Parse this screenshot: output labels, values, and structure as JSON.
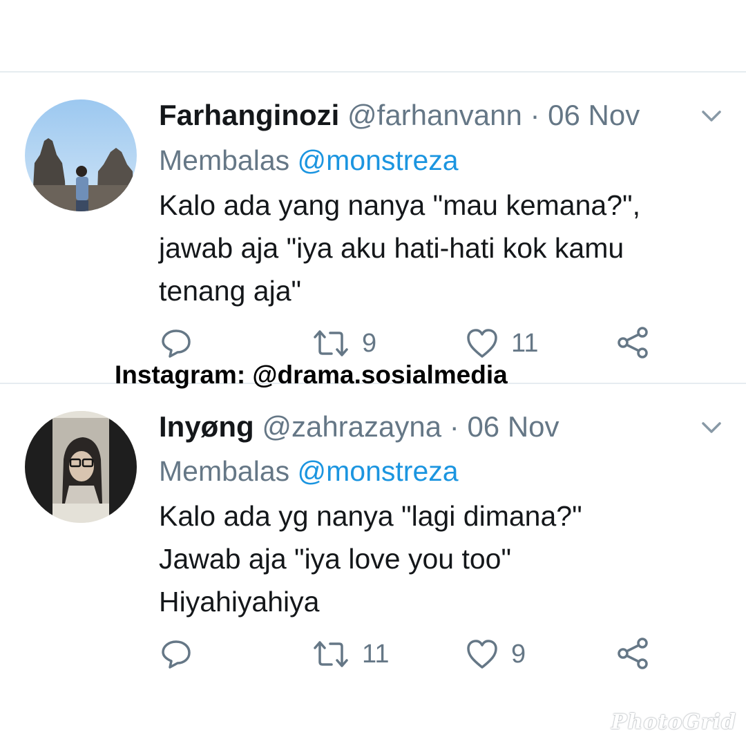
{
  "tweets": [
    {
      "name": "Farhanginozi",
      "handle": "@farhanvann",
      "dot": "·",
      "date": "06 Nov",
      "reply_prefix": "Membalas",
      "reply_to": "@monstreza",
      "lines": [
        "Kalo ada yang nanya \"mau kemana?\",",
        "jawab aja \"iya aku hati-hati kok kamu",
        "tenang aja\""
      ],
      "retweets": "9",
      "likes": "11"
    },
    {
      "name": "Inyøng",
      "handle": "@zahrazayna",
      "dot": "·",
      "date": "06 Nov",
      "reply_prefix": "Membalas",
      "reply_to": "@monstreza",
      "lines": [
        "Kalo ada yg nanya \"lagi dimana?\"",
        "Jawab aja \"iya love you too\"",
        "Hiyahiyahiya"
      ],
      "retweets": "11",
      "likes": "9"
    }
  ],
  "watermark": "Instagram: @drama.sosialmedia",
  "app_watermark": "PhotoGrid",
  "icons": {
    "reply": "reply-icon",
    "retweet": "retweet-icon",
    "like": "heart-icon",
    "share": "share-icon",
    "more": "chevron-down-icon"
  },
  "colors": {
    "text": "#14171a",
    "muted": "#657786",
    "mention": "#1b95e0",
    "divider": "#e6ecf0"
  }
}
